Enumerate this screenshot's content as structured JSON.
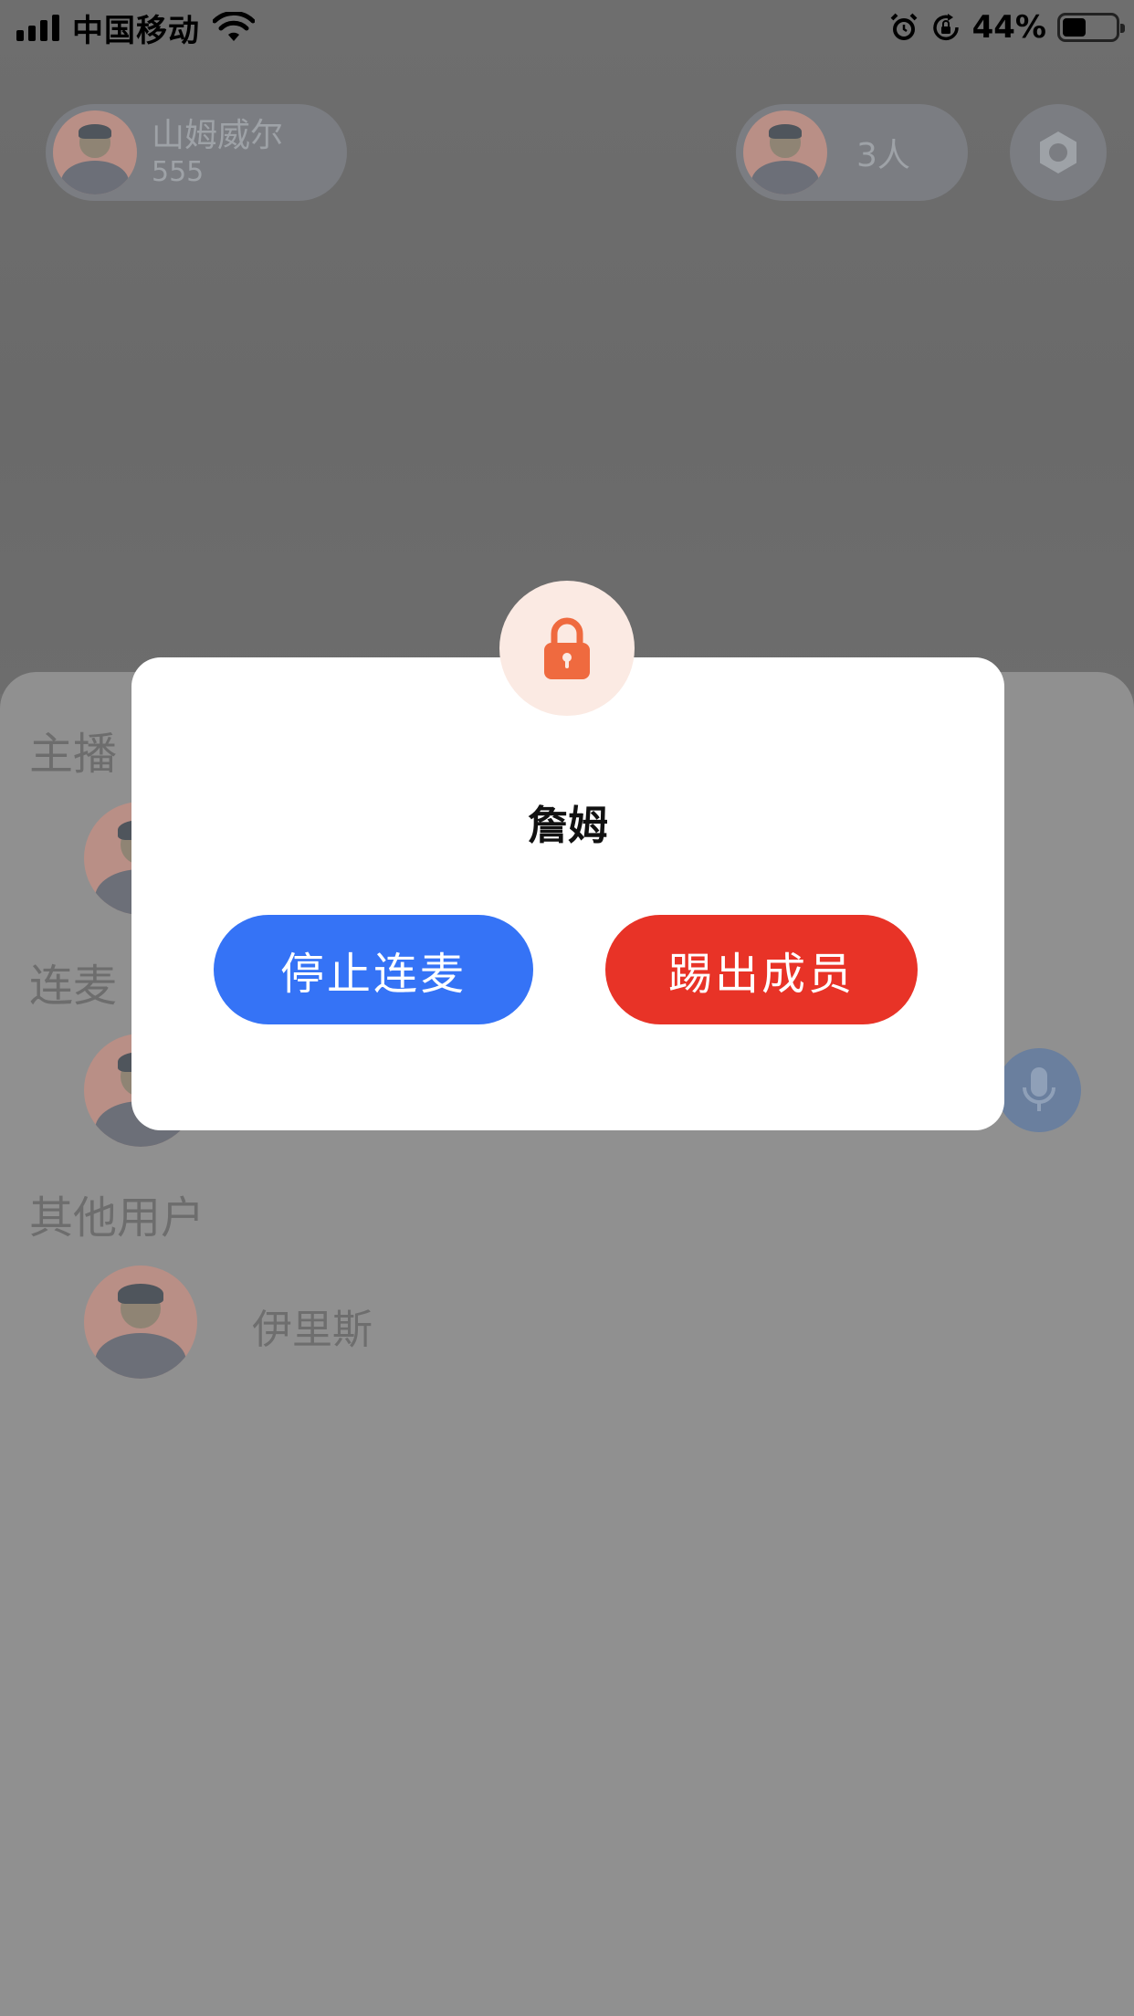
{
  "status_bar": {
    "carrier": "中国移动",
    "battery_percent": "44%",
    "battery_level": 0.44,
    "icons": [
      "signal-icon",
      "wifi-icon",
      "alarm-icon",
      "rotation-lock-icon",
      "battery-icon"
    ]
  },
  "room": {
    "host_name": "山姆威尔",
    "host_id": "555",
    "audience_count": "3人",
    "settings_icon": "gear-icon"
  },
  "sheet": {
    "sections": {
      "host_title": "主播",
      "cohost_title": "连麦",
      "others_title": "其他用户"
    },
    "others": [
      {
        "name": "伊里斯"
      }
    ],
    "mic_icon": "microphone-icon"
  },
  "modal": {
    "icon": "lock-icon",
    "title": "詹姆",
    "stop_label": "停止连麦",
    "kick_label": "踢出成员",
    "colors": {
      "stop": "#3573f6",
      "kick": "#e83327",
      "lock": "#ef6a3f"
    }
  }
}
